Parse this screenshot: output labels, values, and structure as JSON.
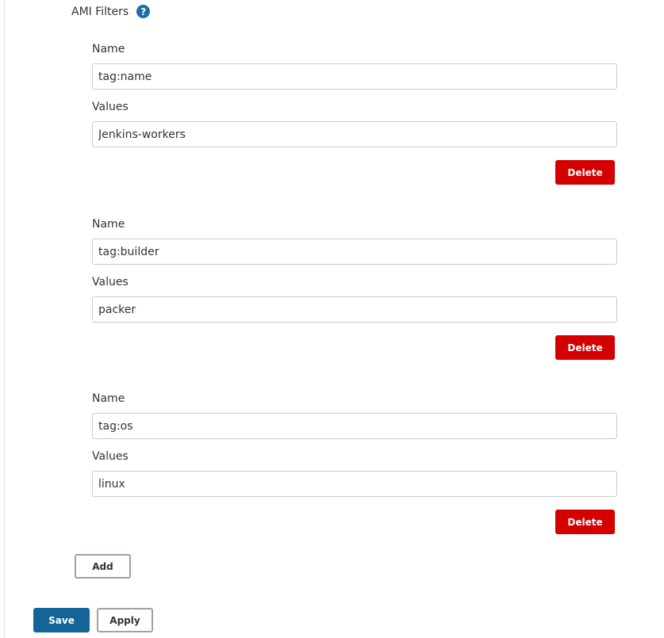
{
  "section": {
    "title": "AMI Filters",
    "help_icon": "question-circle-icon",
    "help_glyph": "?"
  },
  "filters": [
    {
      "name_label": "Name",
      "name_value": "tag:name",
      "values_label": "Values",
      "values_value": "Jenkins-workers",
      "delete_label": "Delete"
    },
    {
      "name_label": "Name",
      "name_value": "tag:builder",
      "values_label": "Values",
      "values_value": "packer",
      "delete_label": "Delete"
    },
    {
      "name_label": "Name",
      "name_value": "tag:os",
      "values_label": "Values",
      "values_value": "linux",
      "delete_label": "Delete"
    }
  ],
  "buttons": {
    "add": "Add",
    "save": "Save",
    "apply": "Apply"
  },
  "colors": {
    "primary": "#136599",
    "danger": "#d40000",
    "help": "#1b6ea8"
  }
}
